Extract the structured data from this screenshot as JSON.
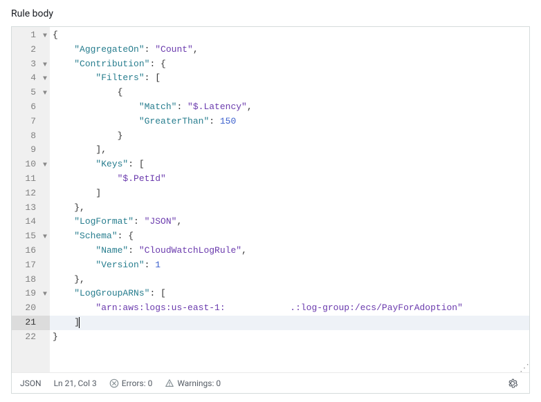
{
  "label": "Rule body",
  "gutter": [
    {
      "n": "1",
      "fold": true
    },
    {
      "n": "2"
    },
    {
      "n": "3",
      "fold": true
    },
    {
      "n": "4",
      "fold": true
    },
    {
      "n": "5",
      "fold": true
    },
    {
      "n": "6"
    },
    {
      "n": "7"
    },
    {
      "n": "8"
    },
    {
      "n": "9"
    },
    {
      "n": "10",
      "fold": true
    },
    {
      "n": "11"
    },
    {
      "n": "12"
    },
    {
      "n": "13"
    },
    {
      "n": "14"
    },
    {
      "n": "15",
      "fold": true
    },
    {
      "n": "16"
    },
    {
      "n": "17"
    },
    {
      "n": "18"
    },
    {
      "n": "19",
      "fold": true
    },
    {
      "n": "20"
    },
    {
      "n": "21",
      "active": true
    },
    {
      "n": "22"
    }
  ],
  "lines": [
    {
      "t": [
        [
          "punc",
          "{"
        ]
      ]
    },
    {
      "i": 1,
      "t": [
        [
          "key",
          "\"AggregateOn\""
        ],
        [
          "punc",
          ": "
        ],
        [
          "str",
          "\"Count\""
        ],
        [
          "punc",
          ","
        ]
      ]
    },
    {
      "i": 1,
      "t": [
        [
          "key",
          "\"Contribution\""
        ],
        [
          "punc",
          ": {"
        ]
      ]
    },
    {
      "i": 2,
      "t": [
        [
          "key",
          "\"Filters\""
        ],
        [
          "punc",
          ": ["
        ]
      ]
    },
    {
      "i": 3,
      "t": [
        [
          "punc",
          "{"
        ]
      ]
    },
    {
      "i": 4,
      "t": [
        [
          "key",
          "\"Match\""
        ],
        [
          "punc",
          ": "
        ],
        [
          "str",
          "\"$.Latency\""
        ],
        [
          "punc",
          ","
        ]
      ]
    },
    {
      "i": 4,
      "t": [
        [
          "key",
          "\"GreaterThan\""
        ],
        [
          "punc",
          ": "
        ],
        [
          "num",
          "150"
        ]
      ]
    },
    {
      "i": 3,
      "t": [
        [
          "punc",
          "}"
        ]
      ]
    },
    {
      "i": 2,
      "t": [
        [
          "punc",
          "],"
        ]
      ]
    },
    {
      "i": 2,
      "t": [
        [
          "key",
          "\"Keys\""
        ],
        [
          "punc",
          ": ["
        ]
      ]
    },
    {
      "i": 3,
      "t": [
        [
          "str",
          "\"$.PetId\""
        ]
      ]
    },
    {
      "i": 2,
      "t": [
        [
          "punc",
          "]"
        ]
      ]
    },
    {
      "i": 1,
      "t": [
        [
          "punc",
          "},"
        ]
      ]
    },
    {
      "i": 1,
      "t": [
        [
          "key",
          "\"LogFormat\""
        ],
        [
          "punc",
          ": "
        ],
        [
          "str",
          "\"JSON\""
        ],
        [
          "punc",
          ","
        ]
      ]
    },
    {
      "i": 1,
      "t": [
        [
          "key",
          "\"Schema\""
        ],
        [
          "punc",
          ": {"
        ]
      ]
    },
    {
      "i": 2,
      "t": [
        [
          "key",
          "\"Name\""
        ],
        [
          "punc",
          ": "
        ],
        [
          "str",
          "\"CloudWatchLogRule\""
        ],
        [
          "punc",
          ","
        ]
      ]
    },
    {
      "i": 2,
      "t": [
        [
          "key",
          "\"Version\""
        ],
        [
          "punc",
          ": "
        ],
        [
          "num",
          "1"
        ]
      ]
    },
    {
      "i": 1,
      "t": [
        [
          "punc",
          "},"
        ]
      ]
    },
    {
      "i": 1,
      "t": [
        [
          "key",
          "\"LogGroupARNs\""
        ],
        [
          "punc",
          ": ["
        ]
      ]
    },
    {
      "i": 2,
      "t": [
        [
          "str",
          "\"arn:aws:logs:us-east-1:            .:log-group:/ecs/PayForAdoption\""
        ]
      ]
    },
    {
      "i": 1,
      "t": [
        [
          "punc",
          "]"
        ]
      ],
      "active": true,
      "cursor": true
    },
    {
      "t": [
        [
          "punc",
          "}"
        ]
      ]
    }
  ],
  "status": {
    "lang": "JSON",
    "pos": "Ln 21, Col 3",
    "errors_label": "Errors: 0",
    "warnings_label": "Warnings: 0"
  }
}
